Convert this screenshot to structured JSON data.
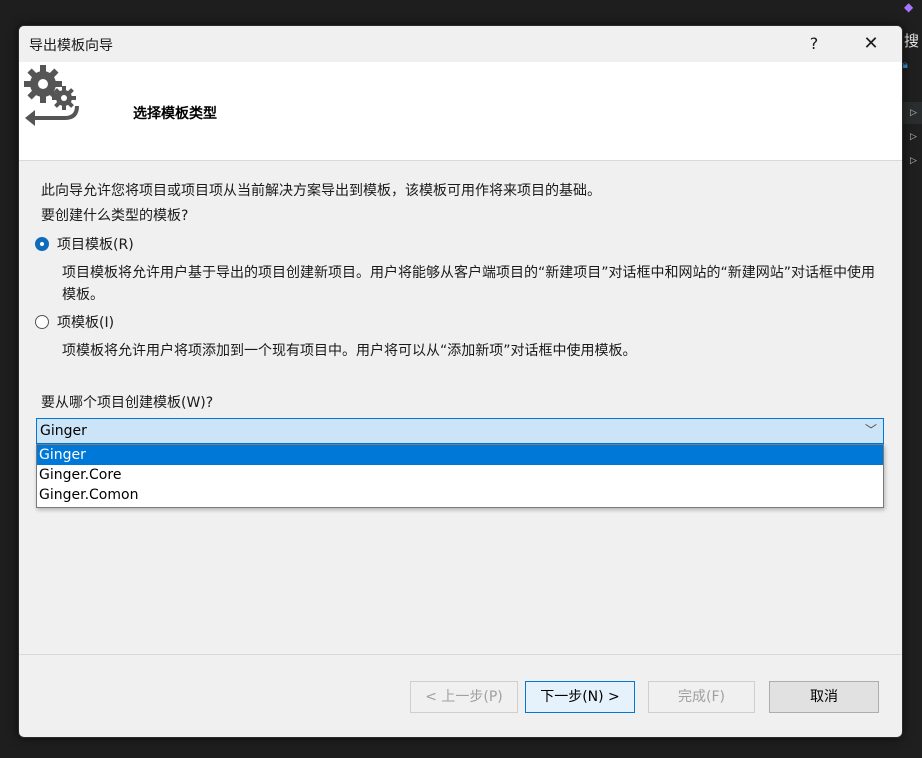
{
  "background_ide": {
    "search_label": "搜"
  },
  "dialog": {
    "title": "导出模板向导",
    "help_label": "?",
    "close_label": "✕",
    "header_title": "选择模板类型",
    "intro_text": "此向导允许您将项目或项目项从当前解决方案导出到模板，该模板可用作将来项目的基础。",
    "template_type_question": "要创建什么类型的模板?",
    "options": [
      {
        "label": "项目模板(R)",
        "checked": true,
        "description": "项目模板将允许用户基于导出的项目创建新项目。用户将能够从客户端项目的“新建项目”对话框中和网站的“新建网站”对话框中使用模板。"
      },
      {
        "label": "项模板(I)",
        "checked": false,
        "description": "项模板将允许用户将项添加到一个现有项目中。用户将可以从“添加新项”对话框中使用模板。"
      }
    ],
    "project_question": "要从哪个项目创建模板(W)?",
    "project_combo": {
      "value": "Ginger",
      "chevron": "﹀",
      "options": [
        "Ginger",
        "Ginger.Core",
        "Ginger.Comon"
      ],
      "highlighted_index": 0
    },
    "buttons": {
      "prev": "< 上一步(P)",
      "next": "下一步(N) >",
      "finish": "完成(F)",
      "cancel": "取消"
    }
  },
  "colors": {
    "accent": "#0078d7",
    "combo_bg": "#cce4f7",
    "dialog_bg": "#f0f0f0"
  }
}
